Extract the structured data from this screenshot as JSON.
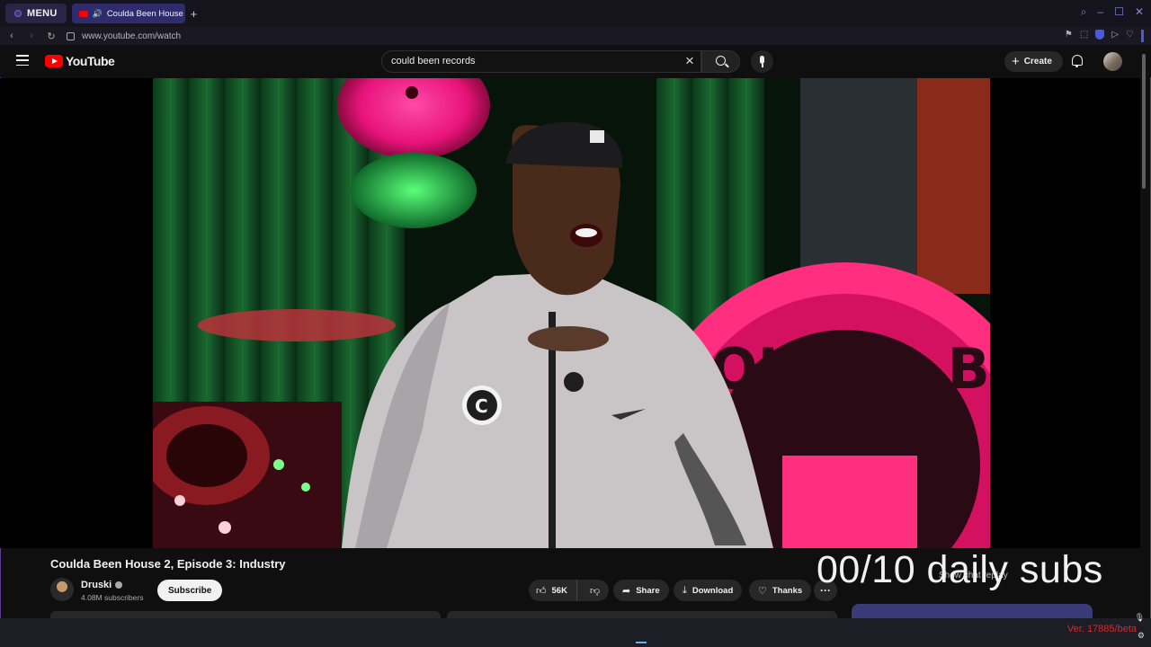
{
  "browser": {
    "menu_label": "MENU",
    "tab_title": "Coulda Been House 2,",
    "url": "www.youtube.com/watch"
  },
  "youtube": {
    "logo_text": "YouTube",
    "search_value": "could been records",
    "create_label": "Create"
  },
  "video": {
    "title": "Coulda Been House 2, Episode 3: Industry",
    "channel_name": "Druski",
    "subscribers": "4.08M subscribers",
    "subscribe_label": "Subscribe",
    "like_count": "56K",
    "share_label": "Share",
    "download_label": "Download",
    "thanks_label": "Thanks",
    "more_label": "···",
    "sign_text": "OULDA BE",
    "patch_text": "C"
  },
  "overlay": {
    "daily_subs": "00/10 daily subs",
    "chat_replay": "Show chat replay",
    "version": "Ver. 17885/beta"
  },
  "icons": {
    "menu": "opera-logo-icon",
    "search": "search-icon",
    "mic": "mic-icon",
    "bell": "bell-icon",
    "like": "thumbs-up-icon",
    "dislike": "thumbs-down-icon",
    "share": "share-icon",
    "download": "download-icon",
    "thanks": "heart-dollar-icon"
  },
  "colors": {
    "yt_red": "#ff0000",
    "accent_purple": "#3a3a78",
    "version_red": "#d62a2a"
  }
}
